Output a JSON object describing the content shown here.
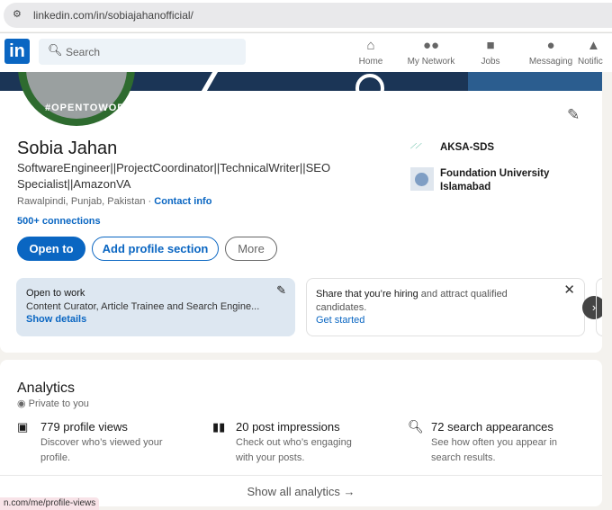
{
  "browser": {
    "url": "linkedin.com/in/sobiajahanofficial/"
  },
  "nav": {
    "logo": "in",
    "search_placeholder": "Search",
    "items": [
      {
        "label": "Home",
        "icon": "home-icon"
      },
      {
        "label": "My Network",
        "icon": "network-icon"
      },
      {
        "label": "Jobs",
        "icon": "briefcase-icon"
      },
      {
        "label": "Messaging",
        "icon": "message-icon"
      },
      {
        "label": "Notific",
        "icon": "bell-icon"
      }
    ]
  },
  "profile": {
    "badge": "#OPENTOWORK",
    "name": "Sobia Jahan",
    "headline": "SoftwareEngineer||ProjectCoordinator||TechnicalWriter||SEO Specialist||AmazonVA",
    "location": "Rawalpindi, Punjab, Pakistan",
    "separator": "·",
    "contact": "Contact info",
    "connections": "500+ connections",
    "company": "AKSA-SDS",
    "education": "Foundation University Islamabad",
    "buttons": {
      "open_to": "Open to",
      "add_section": "Add profile section",
      "more": "More"
    }
  },
  "open_to_work": {
    "title": "Open to work",
    "roles": "Content Curator, Article Trainee and Search Engine...",
    "link": "Show details"
  },
  "hiring": {
    "bold": "Share that you’re hiring",
    "text": " and attract qualified candidates.",
    "link": "Get started"
  },
  "analytics": {
    "title": "Analytics",
    "privacy": "Private to you",
    "stats": [
      {
        "value": "779 profile views",
        "desc": "Discover who’s viewed your profile."
      },
      {
        "value": "20 post impressions",
        "desc": "Check out who’s engaging with your posts."
      },
      {
        "value": "72 search appearances",
        "desc": "See how often you appear in search results."
      }
    ],
    "show_all": "Show all analytics →"
  },
  "status_bar": {
    "url": "n.com/me/profile-views"
  },
  "colors": {
    "brand": "#0a66c2",
    "open_to_work_bg": "#dde7f1",
    "badge_green": "#2e6b2f"
  }
}
